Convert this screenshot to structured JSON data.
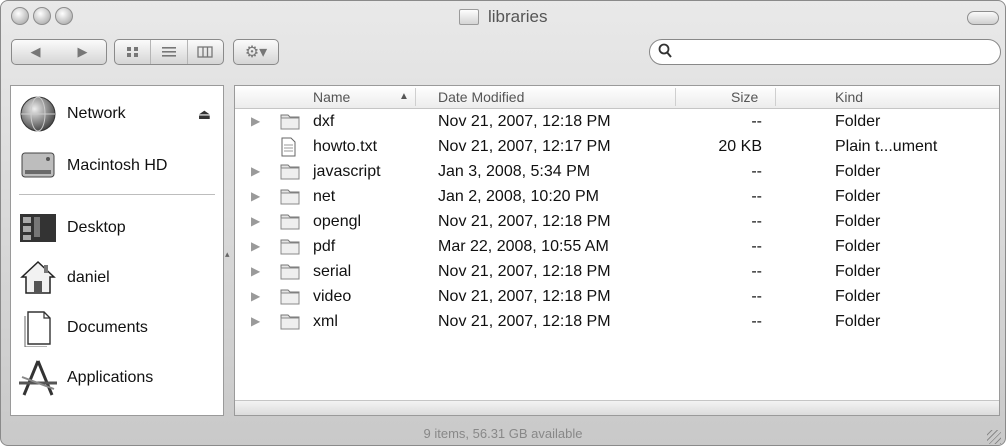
{
  "window": {
    "title": "libraries"
  },
  "toolbar": {
    "back_glyph": "◀",
    "forward_glyph": "▶",
    "action_glyph": "⚙▾",
    "search": {
      "value": "",
      "placeholder": ""
    }
  },
  "sidebar": {
    "items": [
      {
        "label": "Network",
        "icon": "network-globe-icon"
      },
      {
        "label": "Macintosh HD",
        "icon": "hard-drive-icon"
      },
      {
        "label": "Desktop",
        "icon": "desktop-icon"
      },
      {
        "label": "daniel",
        "icon": "home-icon"
      },
      {
        "label": "Documents",
        "icon": "documents-icon"
      },
      {
        "label": "Applications",
        "icon": "applications-icon"
      }
    ]
  },
  "filelist": {
    "columns": {
      "name": "Name",
      "date": "Date Modified",
      "size": "Size",
      "kind": "Kind"
    },
    "rows": [
      {
        "name": "dxf",
        "date": "Nov 21, 2007, 12:18 PM",
        "size": "--",
        "kind": "Folder",
        "icon": "folder-icon",
        "expandable": true
      },
      {
        "name": "howto.txt",
        "date": "Nov 21, 2007, 12:17 PM",
        "size": "20 KB",
        "kind": "Plain t...ument",
        "icon": "text-document-icon",
        "expandable": false
      },
      {
        "name": "javascript",
        "date": "Jan 3, 2008, 5:34 PM",
        "size": "--",
        "kind": "Folder",
        "icon": "folder-icon",
        "expandable": true
      },
      {
        "name": "net",
        "date": "Jan 2, 2008, 10:20 PM",
        "size": "--",
        "kind": "Folder",
        "icon": "folder-icon",
        "expandable": true
      },
      {
        "name": "opengl",
        "date": "Nov 21, 2007, 12:18 PM",
        "size": "--",
        "kind": "Folder",
        "icon": "folder-icon",
        "expandable": true
      },
      {
        "name": "pdf",
        "date": "Mar 22, 2008, 10:55 AM",
        "size": "--",
        "kind": "Folder",
        "icon": "folder-icon",
        "expandable": true
      },
      {
        "name": "serial",
        "date": "Nov 21, 2007, 12:18 PM",
        "size": "--",
        "kind": "Folder",
        "icon": "folder-icon",
        "expandable": true
      },
      {
        "name": "video",
        "date": "Nov 21, 2007, 12:18 PM",
        "size": "--",
        "kind": "Folder",
        "icon": "folder-icon",
        "expandable": true
      },
      {
        "name": "xml",
        "date": "Nov 21, 2007, 12:18 PM",
        "size": "--",
        "kind": "Folder",
        "icon": "folder-icon",
        "expandable": true
      }
    ]
  },
  "status": {
    "text": "9 items, 56.31 GB available"
  }
}
